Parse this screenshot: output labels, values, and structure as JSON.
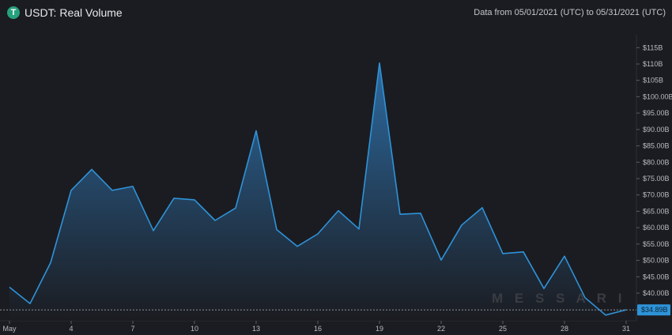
{
  "header": {
    "title": "USDT: Real Volume",
    "date_range": "Data from 05/01/2021 (UTC) to 05/31/2021 (UTC)",
    "logo_letter": "T"
  },
  "watermark": "M E S S A R I",
  "colors": {
    "background": "#1b1c21",
    "line": "#2e93d9",
    "fill_top": "#2e6fa8",
    "fill_bottom": "#1b1c21",
    "tag": "#2e93d9",
    "logo": "#26a17b"
  },
  "chart_data": {
    "type": "area",
    "title": "USDT: Real Volume",
    "x_tick_labels": [
      "May",
      "4",
      "7",
      "10",
      "13",
      "16",
      "19",
      "22",
      "25",
      "28",
      "31"
    ],
    "x_tick_days": [
      1,
      4,
      7,
      10,
      13,
      16,
      19,
      22,
      25,
      28,
      31
    ],
    "y_tick_labels": [
      "$40.00B",
      "$45.00B",
      "$50.00B",
      "$55.00B",
      "$60.00B",
      "$65.00B",
      "$70.00B",
      "$75.00B",
      "$80.00B",
      "$85.00B",
      "$90.00B",
      "$95.00B",
      "$100.00B",
      "$105B",
      "$110B",
      "$115B"
    ],
    "y_tick_values": [
      40,
      45,
      50,
      55,
      60,
      65,
      70,
      75,
      80,
      85,
      90,
      95,
      100,
      105,
      110,
      115
    ],
    "ylim": [
      33,
      117
    ],
    "xlim": [
      1,
      31
    ],
    "unit": "USD billions",
    "current_value_label": "$34.89B",
    "current_value": 34.89,
    "grid": false,
    "series": [
      {
        "x": [
          "2021-05-01",
          "2021-05-02",
          "2021-05-03",
          "2021-05-04",
          "2021-05-05",
          "2021-05-06",
          "2021-05-07",
          "2021-05-08",
          "2021-05-09",
          "2021-05-10",
          "2021-05-11",
          "2021-05-12",
          "2021-05-13",
          "2021-05-14",
          "2021-05-15",
          "2021-05-16",
          "2021-05-17",
          "2021-05-18",
          "2021-05-19",
          "2021-05-20",
          "2021-05-21",
          "2021-05-22",
          "2021-05-23",
          "2021-05-24",
          "2021-05-25",
          "2021-05-26",
          "2021-05-27",
          "2021-05-28",
          "2021-05-29",
          "2021-05-30",
          "2021-05-31"
        ],
        "values": [
          41.8,
          36.8,
          49.3,
          71.4,
          77.8,
          71.4,
          72.6,
          59.1,
          69.0,
          68.5,
          62.2,
          66.0,
          89.6,
          59.4,
          54.3,
          58.1,
          65.2,
          59.6,
          110.3,
          64.1,
          64.4,
          50.1,
          60.8,
          66.1,
          52.1,
          52.6,
          41.4,
          51.3,
          38.6,
          33.3,
          34.9
        ]
      }
    ]
  }
}
